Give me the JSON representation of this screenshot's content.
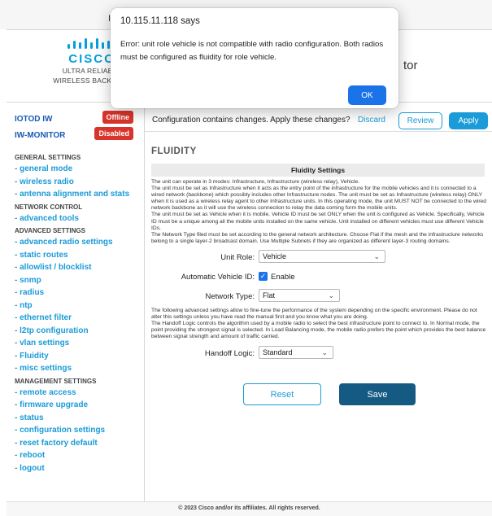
{
  "topstrip": {
    "stray_char": "I"
  },
  "header": {
    "brand_wordmark": "CISCO",
    "tagline_line1": "ULTRA RELIABLE",
    "tagline_line2": "WIRELESS BACKHAUL",
    "product_fragment": "tor"
  },
  "sidebar": {
    "status": [
      {
        "name": "IOTOD IW",
        "badge": "Offline"
      },
      {
        "name": "IW-MONITOR",
        "badge": "Disabled"
      }
    ],
    "sections": [
      {
        "title": "GENERAL SETTINGS",
        "items": [
          "- general mode",
          "- wireless radio",
          "- antenna alignment and stats"
        ]
      },
      {
        "title": "NETWORK CONTROL",
        "items": [
          "- advanced tools"
        ]
      },
      {
        "title": "ADVANCED SETTINGS",
        "items": [
          "- advanced radio settings",
          "- static routes",
          "- allowlist / blocklist",
          "- snmp",
          "- radius",
          "- ntp",
          "- ethernet filter",
          "- l2tp configuration",
          "- vlan settings",
          "- Fluidity",
          "- misc settings"
        ]
      },
      {
        "title": "MANAGEMENT SETTINGS",
        "items": [
          "- remote access",
          "- firmware upgrade",
          "- status",
          "- configuration settings",
          "- reset factory default",
          "- reboot",
          "- logout"
        ]
      }
    ]
  },
  "banner": {
    "message": "Configuration contains changes. Apply these changes?",
    "discard": "Discard",
    "review": "Review",
    "apply": "Apply"
  },
  "main": {
    "title": "FLUIDITY",
    "subhead": "Fluidity Settings",
    "description": "The unit can operate in 3 modes: Infrastructure, Infrastructure (wireless relay), Vehicle.\nThe unit must be set as Infrastructure when it acts as the entry point of the infrastructure for the mobile vehicles and it is connected to a wired network (backbone) which possibly includes other Infrastructure nodes. The unit must be set as Infrastructure (wireless relay) ONLY when it is used as a wireless relay agent to other Infrastructure units. In this operating mode, the unit MUST NOT be connected to the wired network backbone as it will use the wireless connection to relay the data coming form the mobile units.\nThe unit must be set as Vehicle when it is mobile. Vehicle ID must be set ONLY when the unit is configured as Vehicle. Specifically, Vehicle ID must be a unique among all the mobile units installed on the same vehicle. Unit installed on different vehicles must use different Vehicle IDs.\nThe Network Type filed must be set according to the general network architecture. Choose Flat if the mesh and the infrastructure networks belong to a single layer-2 broadcast domain. Use Multiple Subnets if they are organized as different layer-3 routing domains.",
    "unit_role_label": "Unit Role:",
    "unit_role_value": "Vehicle",
    "auto_vehicle_label": "Automatic Vehicle ID:",
    "auto_vehicle_enable": "Enable",
    "network_type_label": "Network Type:",
    "network_type_value": "Flat",
    "advanced_desc": "The following advanced settings allow to fine-tune the performance of the system depending on the specific environment. Please do not alter this settings unless you have read the manual first and you know what you are doing.\nThe Handoff Logic controls the algorithm used by a mobile radio to select the best infrastructure point to connect to. In Normal mode, the point providing the strongest signal is selected. In Load Balancing mode, the mobile radio prefers the point which provides the best balance between signal strength and amount of traffic carried.",
    "handoff_label": "Handoff Logic:",
    "handoff_value": "Standard",
    "reset": "Reset",
    "save": "Save"
  },
  "footer": {
    "text": "© 2023 Cisco and/or its affiliates. All rights reserved."
  },
  "dialog": {
    "title": "10.115.11.118 says",
    "message": "Error: unit role vehicle is not compatible with radio configuration. Both radios must be configured as fluidity for role vehicle.",
    "ok": "OK"
  },
  "colors": {
    "accent": "#1b9bd7",
    "badge": "#d9342b",
    "save": "#155a82",
    "dialog_ok": "#1a73e8"
  },
  "icons": {
    "checkbox": "checkmark-icon",
    "select": "chevron-down-icon"
  }
}
